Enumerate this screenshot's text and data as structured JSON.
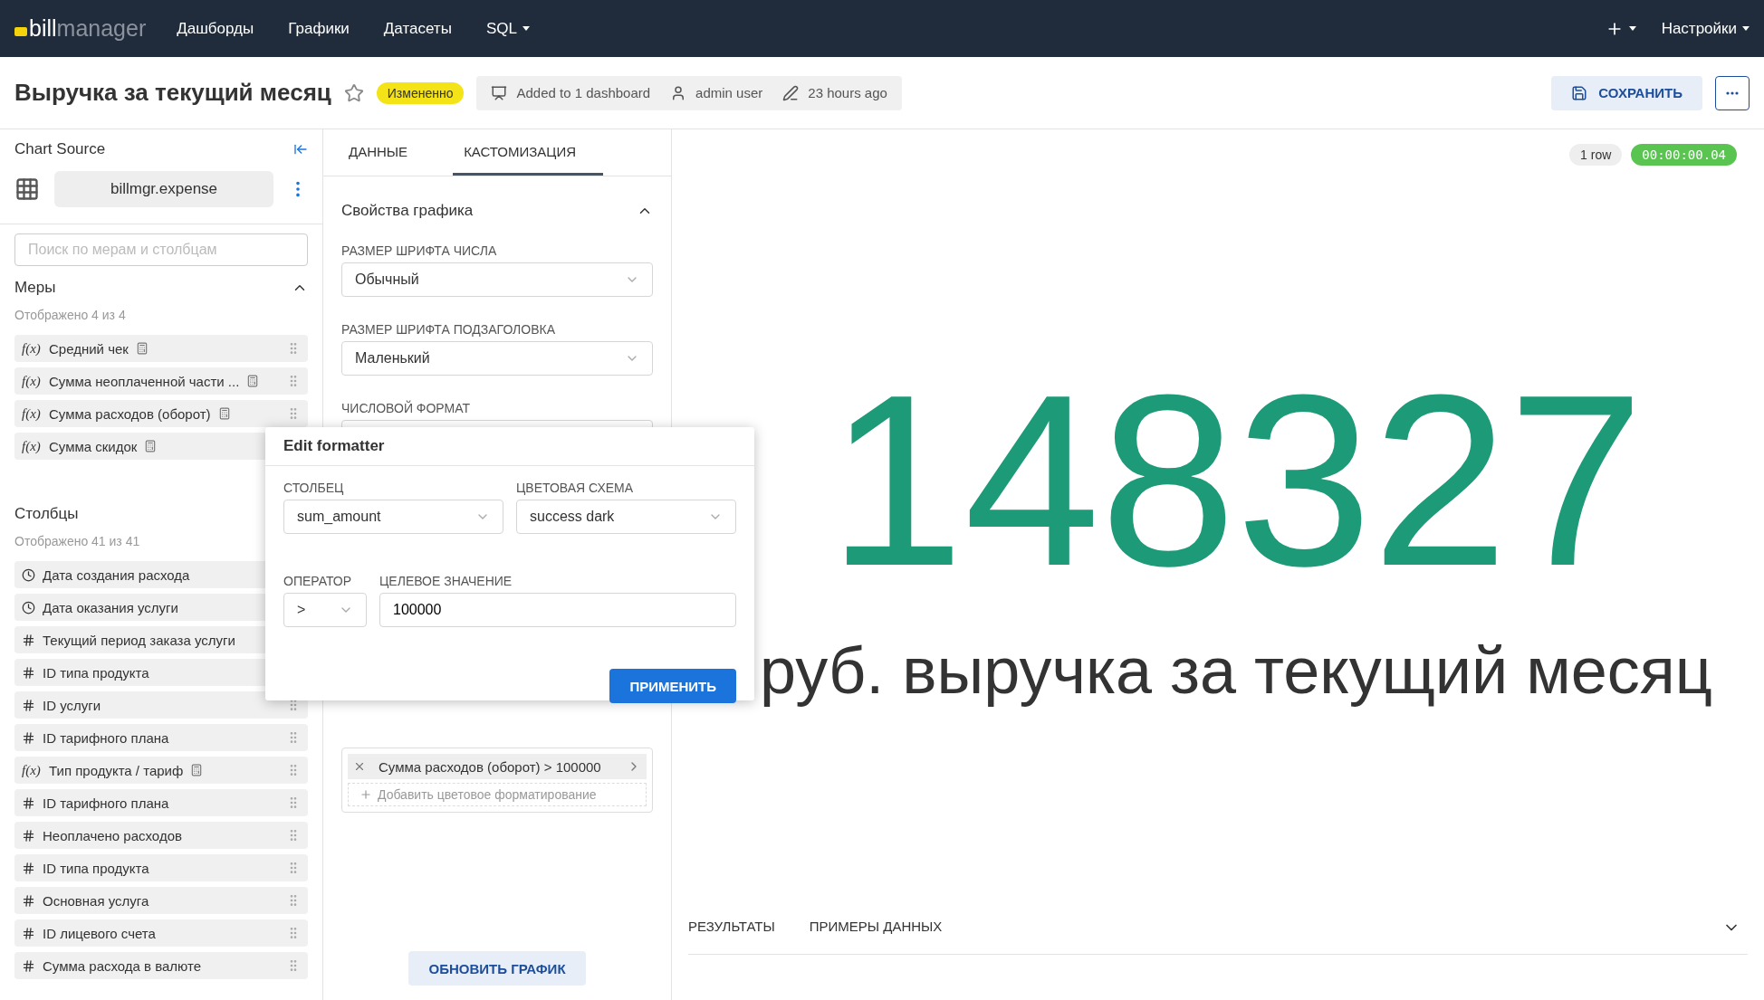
{
  "nav": {
    "logo_bold": "bill",
    "logo_light": "manager",
    "items": [
      {
        "label": "Дашборды",
        "dropdown": false
      },
      {
        "label": "Графики",
        "dropdown": false
      },
      {
        "label": "Датасеты",
        "dropdown": false
      },
      {
        "label": "SQL",
        "dropdown": true
      }
    ],
    "settings": "Настройки"
  },
  "header": {
    "title": "Выручка за текущий месяц",
    "starred": false,
    "status": "Измененно",
    "meta": [
      {
        "kind": "dashboard",
        "text": "Added to 1 dashboard"
      },
      {
        "kind": "user",
        "text": "admin user"
      },
      {
        "kind": "edit",
        "text": "23 hours ago"
      }
    ],
    "save": "СОХРАНИТЬ"
  },
  "sidebar": {
    "title": "Chart Source",
    "dataset": "billmgr.expense",
    "search_placeholder": "Поиск по мерам и столбцам",
    "measures": {
      "title": "Меры",
      "expanded": true,
      "count": "Отображено 4 из 4",
      "items": [
        {
          "kind": "measure",
          "glyph": "f(x)",
          "label": "Средний чек"
        },
        {
          "kind": "measure",
          "glyph": "f(x)",
          "label": "Сумма неоплаченной части ..."
        },
        {
          "kind": "measure",
          "glyph": "f(x)",
          "label": "Сумма расходов (оборот)"
        },
        {
          "kind": "measure",
          "glyph": "f(x)",
          "label": "Сумма скидок"
        }
      ]
    },
    "columns": {
      "title": "Столбцы",
      "count": "Отображено 41 из 41",
      "items": [
        {
          "kind": "time",
          "label": "Дата создания расхода"
        },
        {
          "kind": "time",
          "label": "Дата оказания услуги"
        },
        {
          "kind": "number",
          "label": "Текущий период заказа услуги"
        },
        {
          "kind": "number",
          "label": "ID типа продукта"
        },
        {
          "kind": "number",
          "label": "ID услуги"
        },
        {
          "kind": "number",
          "label": "ID тарифного плана"
        },
        {
          "kind": "measure",
          "glyph": "f(x)",
          "label": "Тип продукта / тариф"
        },
        {
          "kind": "number",
          "label": "ID тарифного плана"
        },
        {
          "kind": "number",
          "label": "Неоплачено расходов"
        },
        {
          "kind": "number",
          "label": "ID типа продукта"
        },
        {
          "kind": "number",
          "label": "Основная услуга"
        },
        {
          "kind": "number",
          "label": "ID лицевого счета"
        },
        {
          "kind": "number",
          "label": "Сумма расхода в валюте"
        }
      ]
    }
  },
  "editor": {
    "tabs": [
      {
        "label": "ДАННЫЕ",
        "selected": false
      },
      {
        "label": "КАСТОМИЗАЦИЯ",
        "selected": true
      }
    ],
    "section": {
      "title": "Свойства графика",
      "expanded": true
    },
    "fields": [
      {
        "label": "РАЗМЕР ШРИФТА ЧИСЛА",
        "value": "Обычный"
      },
      {
        "label": "РАЗМЕР ШРИФТА ПОДЗАГОЛОВКА",
        "value": "Маленький"
      },
      {
        "label": "ЧИСЛОВОЙ ФОРМАТ"
      }
    ],
    "rules": [
      {
        "text": "Сумма расходов (оборот) > 100000"
      }
    ],
    "add_rule": "Добавить цветовое форматирование",
    "update": "ОБНОВИТЬ ГРАФИК"
  },
  "popup": {
    "title": "Edit formatter",
    "column_label": "СТОЛБЕЦ",
    "column": "sum_amount",
    "scheme_label": "ЦВЕТОВАЯ СХЕМА",
    "scheme": "success dark",
    "operator_label": "ОПЕРАТОР",
    "operator": ">",
    "target_label": "ЦЕЛЕВОЕ ЗНАЧЕНИЕ",
    "target": "100000",
    "apply": "ПРИМЕНИТЬ"
  },
  "result": {
    "rows": "1 row",
    "timer": "00:00:00.04",
    "number": "148327",
    "subtitle": "руб. выручка за текущий месяц",
    "tabs": [
      {
        "label": "РЕЗУЛЬТАТЫ",
        "selected": false
      },
      {
        "label": "ПРИМЕРЫ ДАННЫХ",
        "selected": false
      }
    ]
  }
}
